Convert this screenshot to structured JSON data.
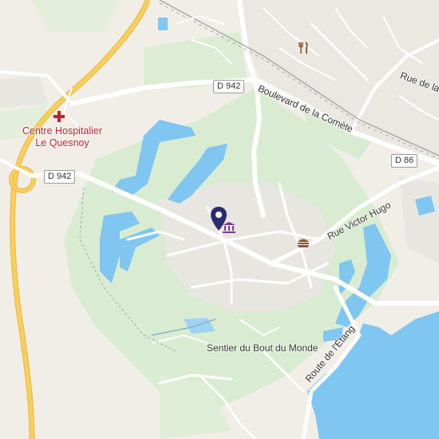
{
  "map": {
    "poi": {
      "hospital_label_line1": "Centre Hospitalier",
      "hospital_label_line2": "Le Quesnoy"
    },
    "road_shields": {
      "d942_north": "D 942",
      "d942_west": "D 942",
      "d86": "D 86"
    },
    "street_labels": {
      "boulevard": "Boulevard de la Comète",
      "rue_de_la": "Rue de la",
      "victor_hugo": "Rue Victor Hugo",
      "etang": "Route de l'Étang",
      "sentier": "Sentier du Bout du Monde"
    },
    "icons": {
      "hospital": "hospital-cross-icon",
      "restaurant": "restaurant-icon",
      "fastfood": "burger-icon",
      "museum": "museum-icon",
      "pin": "location-pin-icon"
    },
    "colors": {
      "water": "#7fc6f0",
      "park": "#d9ecd1",
      "highway": "#f7cf5a",
      "hospital": "#c0212f",
      "pin": "#2a2e6e"
    }
  }
}
